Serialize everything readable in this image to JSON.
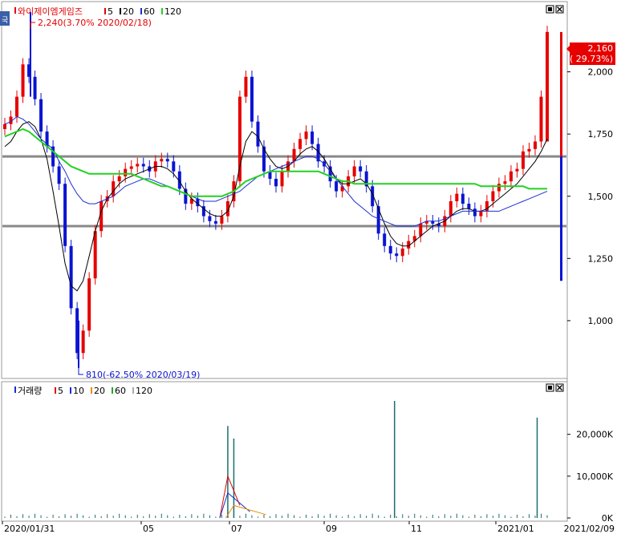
{
  "colors": {
    "up": "#e60000",
    "down": "#0a14d2",
    "ma5": "#000000",
    "ma20": "#000000",
    "ma60": "#1a2fd0",
    "ma120": "#22d222",
    "hline": "#888888",
    "vma5": "#e60000",
    "vma10": "#1a2fd0",
    "vma20": "#e39000",
    "vma60": "#22aa22",
    "vma120": "#aaaaaa",
    "volume": "#1b6e6e"
  },
  "icons": {
    "side_tab": "collapse-tab-icon",
    "panel_buttons": [
      "maximize-icon",
      "close-icon"
    ]
  },
  "price_panel": {
    "title": "와이제이엠게임즈",
    "legend": [
      {
        "label": "5",
        "color": "#e60000"
      },
      {
        "label": "20",
        "color": "#000000"
      },
      {
        "label": "60",
        "color": "#1a2fd0"
      },
      {
        "label": "120",
        "color": "#22d222"
      }
    ],
    "high_annotation": "2,240(3.70% 2020/02/18)",
    "low_annotation": "810(-62.50% 2020/03/19)",
    "current_price": "2,160",
    "current_change": "( 29.73%)",
    "y_ticks": [
      "2,000",
      "1,750",
      "1,500",
      "1,250",
      "1,000"
    ]
  },
  "volume_panel": {
    "title": "거래량",
    "legend": [
      {
        "label": "5",
        "color": "#e60000"
      },
      {
        "label": "10",
        "color": "#1a2fd0"
      },
      {
        "label": "20",
        "color": "#e39000"
      },
      {
        "label": "60",
        "color": "#22aa22"
      },
      {
        "label": "120",
        "color": "#aaaaaa"
      }
    ],
    "y_ticks": [
      "20,000K",
      "10,000K",
      "0K"
    ]
  },
  "x_ticks": [
    "2020/01/31",
    "05",
    "07",
    "09",
    "11",
    "2021/01"
  ],
  "last_date": "2021/02/09",
  "chart_data": {
    "type": "candlestick",
    "title": "와이제이엠게임즈",
    "x_range": [
      "2020/01/31",
      "2021/02/09"
    ],
    "price_range": [
      800,
      2250
    ],
    "horizontal_lines": [
      1660,
      1380
    ],
    "high": {
      "value": 2240,
      "date": "2020/02/18",
      "change_pct": 3.7
    },
    "low": {
      "value": 810,
      "date": "2020/03/19",
      "change_pct": -62.5
    },
    "last": {
      "value": 2160,
      "change_pct": 29.73
    },
    "price_series": {
      "x": [
        0,
        3,
        6,
        9,
        12,
        15,
        18,
        21,
        24,
        27,
        30,
        33,
        36,
        39,
        42,
        45,
        48,
        51,
        54,
        57,
        60,
        63,
        66,
        69,
        72,
        75,
        78,
        81,
        84,
        87,
        90,
        93,
        96,
        99,
        102,
        105,
        108,
        111,
        114,
        117,
        120,
        123,
        126,
        129,
        132,
        135,
        138,
        141,
        144,
        147,
        150,
        153,
        156,
        159,
        162,
        165,
        168,
        171,
        174,
        177,
        180,
        183,
        186,
        189,
        192,
        195,
        198,
        201,
        204,
        207,
        210,
        213,
        216,
        219,
        222,
        225,
        228,
        231,
        234,
        237,
        240,
        243,
        246,
        249,
        252,
        255,
        258,
        261,
        264,
        267,
        270
      ],
      "close": [
        1790,
        1820,
        1900,
        2030,
        1980,
        1890,
        1760,
        1700,
        1620,
        1550,
        1300,
        1050,
        870,
        960,
        1170,
        1360,
        1480,
        1500,
        1560,
        1580,
        1610,
        1620,
        1630,
        1620,
        1600,
        1640,
        1650,
        1640,
        1600,
        1530,
        1470,
        1490,
        1460,
        1420,
        1400,
        1390,
        1420,
        1480,
        1560,
        1900,
        1980,
        1800,
        1700,
        1600,
        1570,
        1540,
        1600,
        1640,
        1690,
        1730,
        1760,
        1710,
        1640,
        1620,
        1560,
        1520,
        1540,
        1580,
        1620,
        1600,
        1540,
        1460,
        1350,
        1300,
        1270,
        1260,
        1290,
        1320,
        1340,
        1390,
        1400,
        1390,
        1380,
        1420,
        1480,
        1510,
        1470,
        1450,
        1420,
        1440,
        1480,
        1520,
        1550,
        1560,
        1600,
        1610,
        1680,
        1690,
        1720,
        1900,
        2160
      ]
    },
    "moving_averages": {
      "ma5": [
        1790,
        1810,
        1880,
        1990,
        1990,
        1920,
        1800,
        1720,
        1640,
        1570,
        1400,
        1180,
        980,
        950,
        1080,
        1260,
        1410,
        1490,
        1540,
        1570,
        1600,
        1615,
        1625,
        1620,
        1610,
        1625,
        1640,
        1640,
        1610,
        1560,
        1500,
        1485,
        1470,
        1440,
        1415,
        1400,
        1410,
        1460,
        1540,
        1780,
        1930,
        1860,
        1740,
        1640,
        1590,
        1560,
        1580,
        1630,
        1670,
        1710,
        1740,
        1715,
        1660,
        1625,
        1575,
        1535,
        1535,
        1570,
        1600,
        1595,
        1545,
        1470,
        1380,
        1320,
        1285,
        1270,
        1285,
        1310,
        1335,
        1375,
        1395,
        1390,
        1385,
        1410,
        1460,
        1495,
        1480,
        1455,
        1430,
        1440,
        1470,
        1510,
        1540,
        1555,
        1590,
        1605,
        1660,
        1685,
        1710,
        1850,
        2010
      ],
      "ma20": [
        1700,
        1720,
        1760,
        1790,
        1800,
        1780,
        1730,
        1650,
        1520,
        1380,
        1230,
        1140,
        1120,
        1160,
        1260,
        1360,
        1440,
        1490,
        1520,
        1550,
        1570,
        1580,
        1590,
        1600,
        1610,
        1620,
        1620,
        1610,
        1590,
        1560,
        1520,
        1490,
        1470,
        1450,
        1430,
        1420,
        1420,
        1440,
        1500,
        1620,
        1720,
        1760,
        1740,
        1690,
        1650,
        1620,
        1610,
        1620,
        1640,
        1670,
        1690,
        1700,
        1680,
        1650,
        1610,
        1570,
        1550,
        1550,
        1560,
        1570,
        1550,
        1510,
        1450,
        1390,
        1340,
        1310,
        1300,
        1300,
        1320,
        1340,
        1360,
        1380,
        1390,
        1400,
        1420,
        1440,
        1450,
        1450,
        1440,
        1440,
        1450,
        1470,
        1490,
        1510,
        1530,
        1550,
        1580,
        1610,
        1640,
        1680,
        1730
      ],
      "ma60": [
        1790,
        1800,
        1820,
        1810,
        1790,
        1760,
        1730,
        1710,
        1690,
        1640,
        1600,
        1550,
        1510,
        1480,
        1470,
        1470,
        1480,
        1490,
        1500,
        1520,
        1540,
        1550,
        1560,
        1570,
        1570,
        1560,
        1550,
        1540,
        1530,
        1520,
        1510,
        1500,
        1490,
        1480,
        1480,
        1480,
        1490,
        1500,
        1510,
        1520,
        1540,
        1560,
        1580,
        1590,
        1600,
        1610,
        1620,
        1630,
        1640,
        1650,
        1660,
        1660,
        1650,
        1630,
        1600,
        1570,
        1540,
        1510,
        1480,
        1460,
        1440,
        1420,
        1410,
        1400,
        1390,
        1380,
        1380,
        1380,
        1380,
        1390,
        1400,
        1400,
        1400,
        1410,
        1420,
        1430,
        1440,
        1440,
        1440,
        1440,
        1440,
        1440,
        1440,
        1450,
        1460,
        1470,
        1480,
        1490,
        1500,
        1510,
        1520
      ],
      "ma120": [
        1740,
        1750,
        1760,
        1770,
        1760,
        1740,
        1720,
        1700,
        1680,
        1660,
        1640,
        1620,
        1610,
        1600,
        1590,
        1590,
        1590,
        1590,
        1590,
        1590,
        1590,
        1590,
        1580,
        1570,
        1560,
        1550,
        1540,
        1540,
        1530,
        1520,
        1510,
        1500,
        1500,
        1500,
        1500,
        1500,
        1500,
        1510,
        1520,
        1540,
        1560,
        1570,
        1580,
        1590,
        1600,
        1600,
        1600,
        1600,
        1600,
        1600,
        1600,
        1600,
        1600,
        1590,
        1580,
        1570,
        1560,
        1560,
        1550,
        1550,
        1550,
        1550,
        1550,
        1550,
        1550,
        1550,
        1550,
        1550,
        1550,
        1550,
        1550,
        1550,
        1550,
        1550,
        1550,
        1550,
        1550,
        1550,
        1550,
        1540,
        1540,
        1540,
        1540,
        1540,
        1540,
        1540,
        1540,
        1530,
        1530,
        1530,
        1530
      ]
    },
    "volume_spikes_K": [
      {
        "x": 111,
        "value": 22000
      },
      {
        "x": 114,
        "value": 19000
      },
      {
        "x": 194,
        "value": 28000
      },
      {
        "x": 265,
        "value": 24000
      }
    ],
    "volume_ylim": [
      0,
      28000
    ]
  }
}
